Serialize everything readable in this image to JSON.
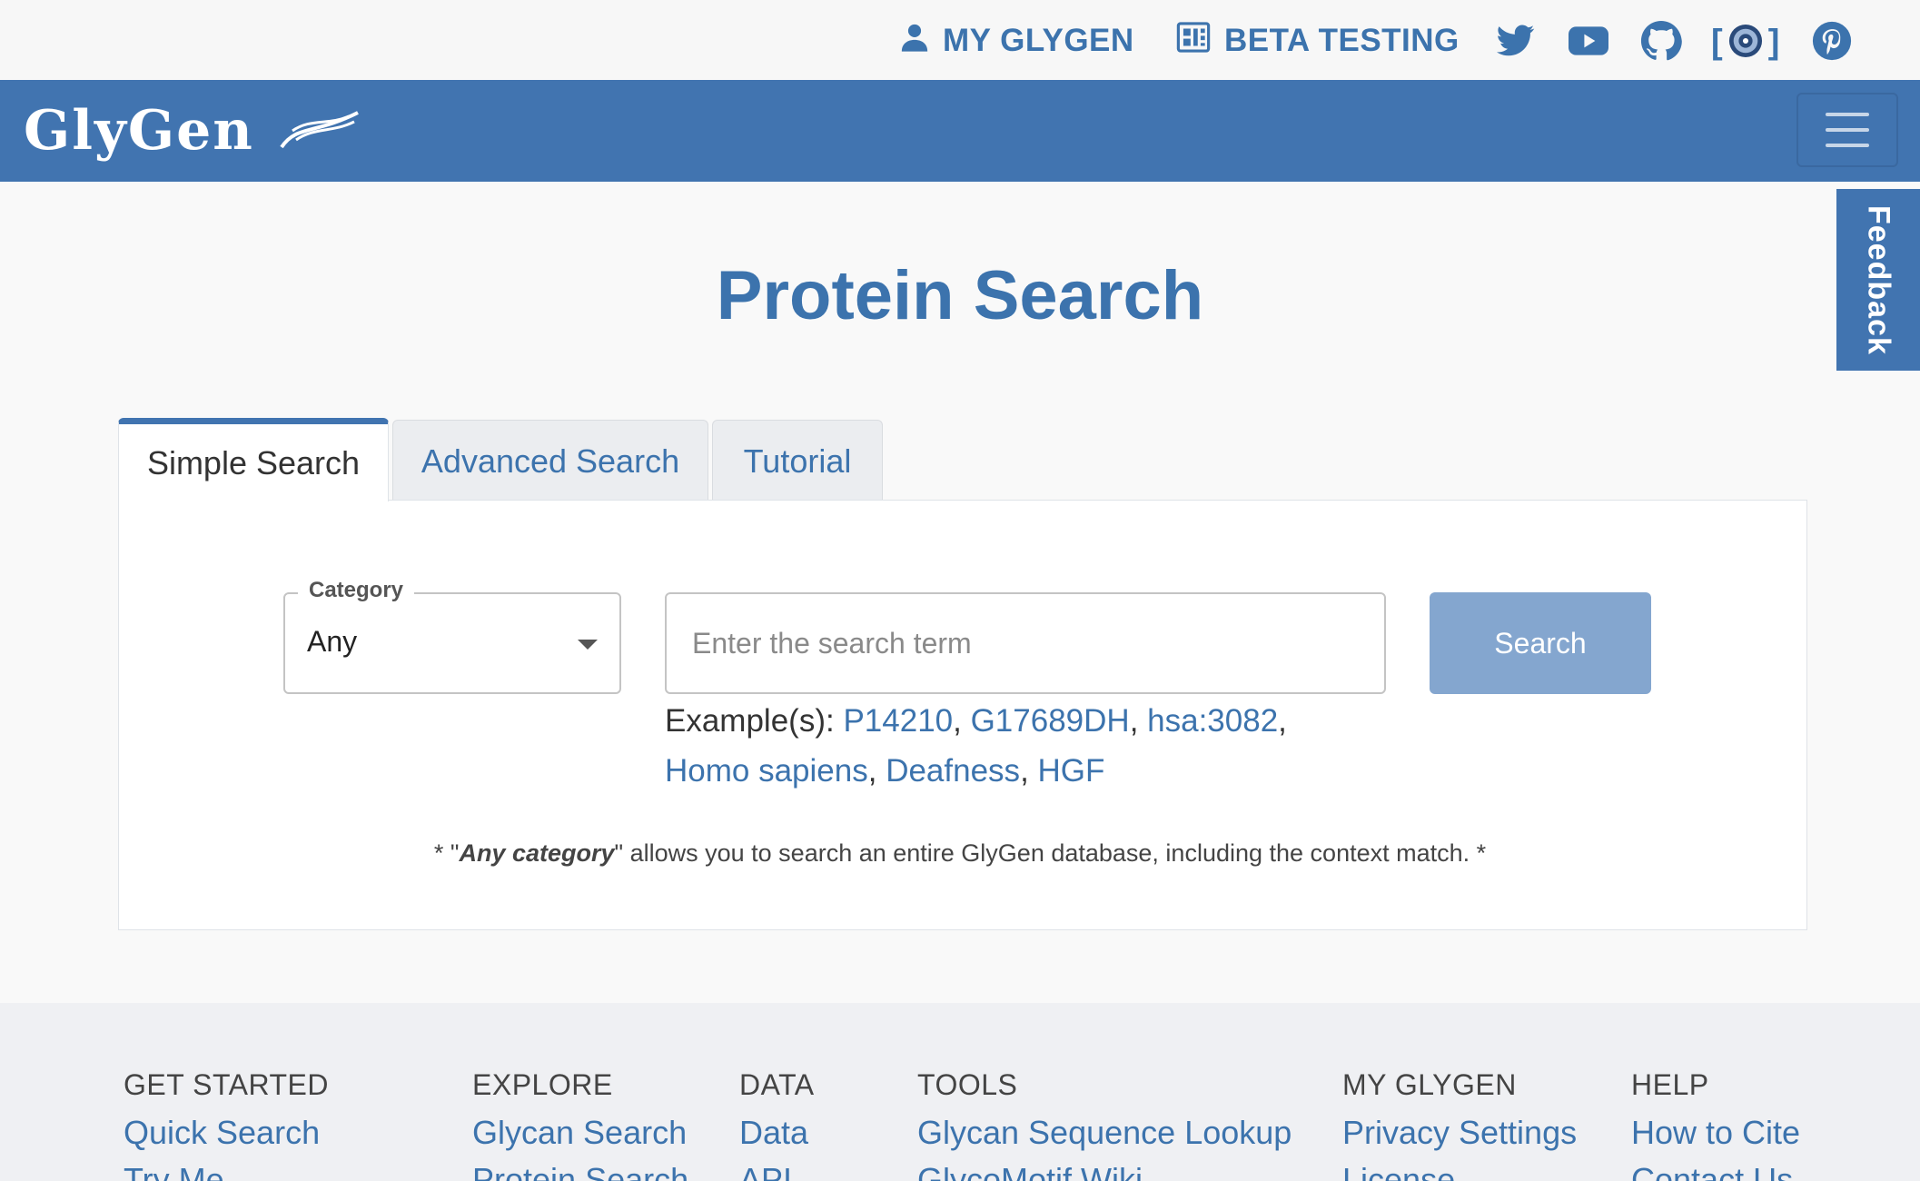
{
  "topbar": {
    "my_glygen": "MY GLYGEN",
    "beta_testing": "BETA TESTING",
    "social": [
      "twitter-icon",
      "youtube-icon",
      "github-icon",
      "wordpress-icon",
      "pinterest-icon"
    ]
  },
  "navbar": {
    "brand": "GlyGen"
  },
  "feedback": "Feedback",
  "page": {
    "title": "Protein Search"
  },
  "tabs": [
    {
      "label": "Simple Search"
    },
    {
      "label": "Advanced Search"
    },
    {
      "label": "Tutorial"
    }
  ],
  "form": {
    "category_label": "Category",
    "category_value": "Any",
    "search_placeholder": "Enter the search term",
    "search_button": "Search",
    "examples_label": "Example(s):",
    "examples": [
      "P14210",
      "G17689DH",
      "hsa:3082",
      "Homo sapiens",
      "Deafness",
      "HGF"
    ]
  },
  "note": {
    "prefix": "* \"",
    "bold": "Any category",
    "suffix": "\" allows you to search an entire GlyGen database, including the context match. *"
  },
  "footer": {
    "columns": [
      {
        "heading": "GET STARTED",
        "links": [
          "Quick Search",
          "Try Me"
        ]
      },
      {
        "heading": "EXPLORE",
        "links": [
          "Glycan Search",
          "Protein Search"
        ]
      },
      {
        "heading": "DATA",
        "links": [
          "Data",
          "API"
        ]
      },
      {
        "heading": "TOOLS",
        "links": [
          "Glycan Sequence Lookup",
          "GlycoMotif Wiki"
        ]
      },
      {
        "heading": "MY GLYGEN",
        "links": [
          "Privacy Settings",
          "License"
        ]
      },
      {
        "heading": "HELP",
        "links": [
          "How to Cite",
          "Contact Us"
        ]
      }
    ]
  },
  "colors": {
    "brand": "#4174b0",
    "link": "#3c73ad",
    "button_disabled": "#84a6cf",
    "footer_bg": "#eff0f3"
  }
}
